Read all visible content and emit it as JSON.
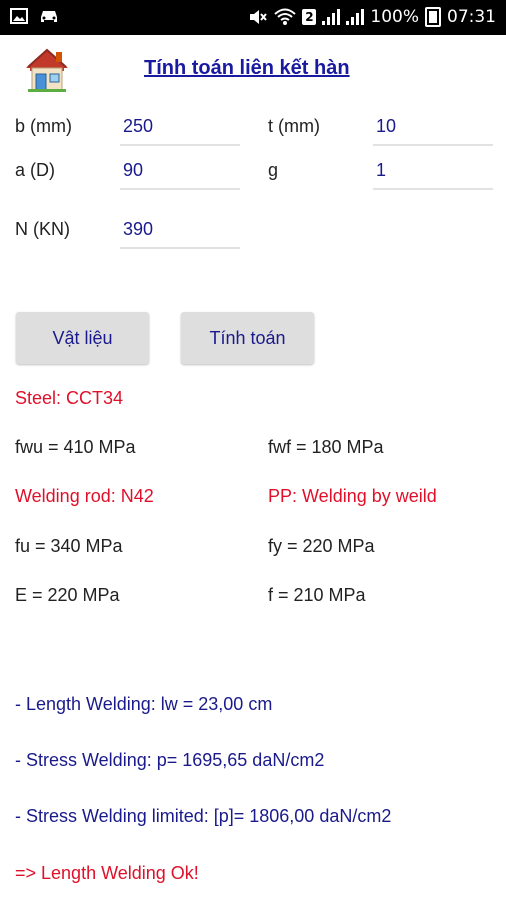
{
  "status": {
    "battery_percent": "100%",
    "time": "07:31",
    "sim_badge": "2"
  },
  "header": {
    "title": "Tính toán liên kết hàn",
    "home_icon": "house-icon"
  },
  "inputs": {
    "b": {
      "label": "b (mm)",
      "value": "250"
    },
    "t": {
      "label": "t (mm)",
      "value": "10"
    },
    "a": {
      "label": "a (D)",
      "value": "90"
    },
    "g": {
      "label": "g",
      "value": "1"
    },
    "n": {
      "label": "N (KN)",
      "value": "390"
    }
  },
  "buttons": {
    "material": "Vật liệu",
    "calculate": "Tính toán"
  },
  "material": {
    "steel": "Steel: CCT34",
    "fwu": "fwu = 410 MPa",
    "fwf": "fwf = 180 MPa",
    "rod": "Welding rod: N42",
    "pp": "PP: Welding by weild",
    "fu": "fu = 340 MPa",
    "fy": "fy = 220 MPa",
    "e": "E = 220 MPa",
    "f": "f = 210 MPa"
  },
  "results": {
    "length": "- Length Welding: lw = 23,00 cm",
    "stress": "- Stress Welding: p= 1695,65 daN/cm2",
    "limit": "- Stress Welding limited: [p]= 1806,00 daN/cm2",
    "verdict": "=> Length Welding Ok!"
  },
  "colors": {
    "accent_navy": "#1a1aa0",
    "alert_red": "#e0102a"
  }
}
